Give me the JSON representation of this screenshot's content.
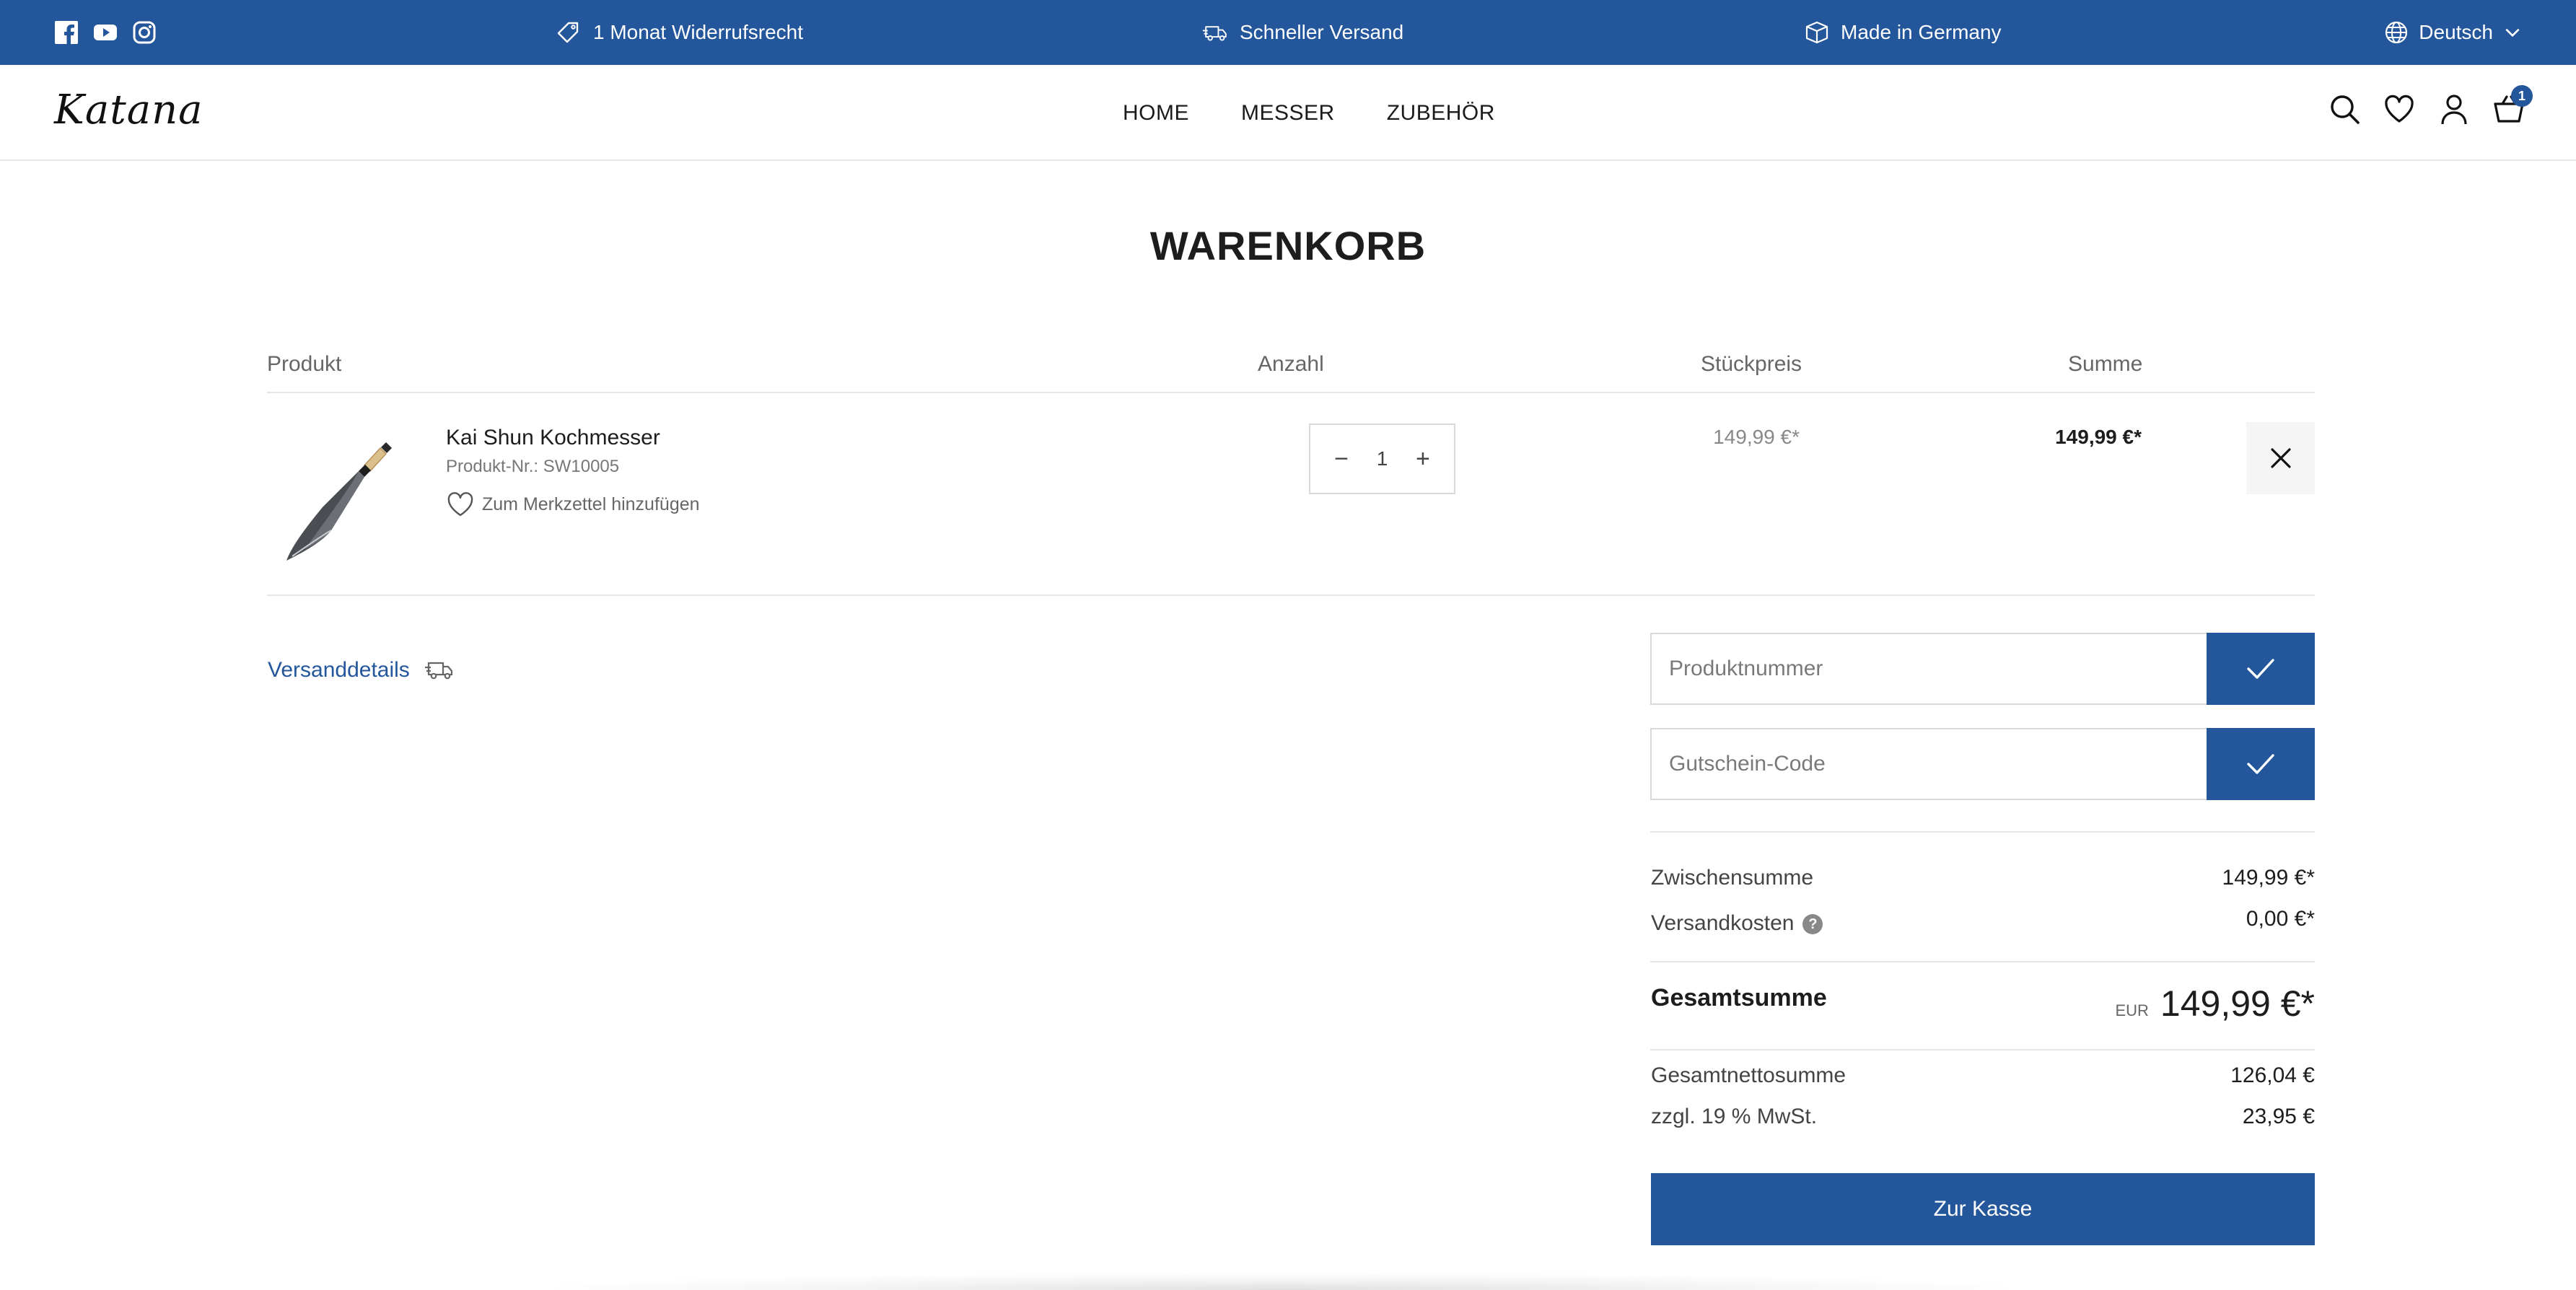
{
  "topbar": {
    "social": [
      "facebook-icon",
      "youtube-icon",
      "instagram-icon"
    ],
    "usp": [
      {
        "icon": "tag-icon",
        "label": "1 Monat Widerrufsrecht"
      },
      {
        "icon": "truck-icon",
        "label": "Schneller Versand"
      },
      {
        "icon": "box-icon",
        "label": "Made in Germany"
      }
    ],
    "language": "Deutsch"
  },
  "header": {
    "logo": "Katana",
    "nav": [
      "HOME",
      "MESSER",
      "ZUBEHÖR"
    ],
    "cart_count": "1"
  },
  "page": {
    "title": "WARENKORB"
  },
  "table": {
    "headers": {
      "product": "Produkt",
      "quantity": "Anzahl",
      "unit_price": "Stückpreis",
      "total": "Summe"
    },
    "items": [
      {
        "name": "Kai Shun Kochmesser",
        "sku": "Produkt-Nr.: SW10005",
        "wishlist": "Zum Merkzettel hinzufügen",
        "quantity": "1",
        "unit_price": "149,99 €*",
        "total": "149,99 €*"
      }
    ]
  },
  "shipping": {
    "link": "Versanddetails"
  },
  "forms": {
    "product_number_placeholder": "Produktnummer",
    "voucher_placeholder": "Gutschein-Code"
  },
  "summary": {
    "subtotal_label": "Zwischensumme",
    "subtotal_value": "149,99 €*",
    "shipping_label": "Versandkosten",
    "shipping_help": "?",
    "shipping_value": "0,00 €*",
    "grand_label": "Gesamtsumme",
    "grand_currency": "EUR",
    "grand_value": "149,99 €*",
    "net_label": "Gesamtnettosumme",
    "net_value": "126,04 €",
    "tax_label": "zzgl. 19 % MwSt.",
    "tax_value": "23,95 €",
    "checkout_label": "Zur Kasse"
  },
  "colors": {
    "brand": "#23569a"
  }
}
